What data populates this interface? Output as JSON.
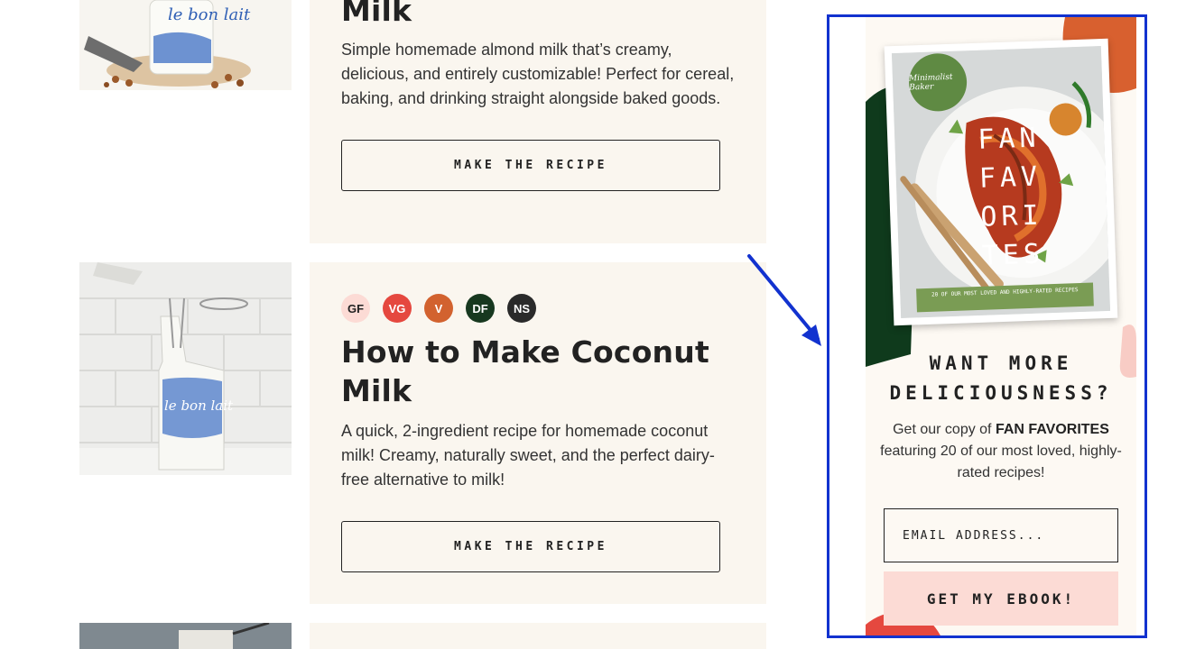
{
  "recipes": [
    {
      "title": "Milk",
      "description": "Simple homemade almond milk that’s creamy, delicious, and entirely customizable! Perfect for cereal, baking, and drinking straight alongside baked goods.",
      "button_label": "MAKE THE RECIPE",
      "jar_label": "le bon lait"
    },
    {
      "badges": [
        {
          "label": "GF",
          "color": "#fcdbd5",
          "text_color": "#222222"
        },
        {
          "label": "VG",
          "color": "#e5483f",
          "text_color": "#ffffff"
        },
        {
          "label": "V",
          "color": "#d2622f",
          "text_color": "#ffffff"
        },
        {
          "label": "DF",
          "color": "#17381f",
          "text_color": "#ffffff"
        },
        {
          "label": "NS",
          "color": "#2a2a2a",
          "text_color": "#ffffff"
        }
      ],
      "title": "How to Make Coconut Milk",
      "description": "A quick, 2-ingredient recipe for homemade coconut milk! Creamy, naturally sweet, and the perfect dairy-free alternative to milk!",
      "button_label": "MAKE THE RECIPE",
      "jar_label": "le bon lait"
    }
  ],
  "widget": {
    "ebook": {
      "brand": "Minimalist Baker",
      "title": "FAN\nFAV\nORI\nTES",
      "strip": "20 OF OUR MOST LOVED AND HIGHLY-RATED RECIPES"
    },
    "heading": "WANT MORE DELICIOUSNESS?",
    "text_prefix": "Get our copy of ",
    "text_bold": "FAN FAVORITES",
    "text_suffix": " featuring 20 of our most loved, highly-rated recipes!",
    "email_placeholder": "EMAIL ADDRESS...",
    "cta_label": "GET MY EBOOK!"
  },
  "colors": {
    "accent_border": "#1232cf",
    "card_bg": "#faf6ef",
    "panel_bg": "#fdf9f3",
    "cta_bg": "#fcdbd5",
    "blob_green": "#0f3a1c",
    "blob_orange": "#d8602f",
    "blob_red": "#e5483f"
  }
}
